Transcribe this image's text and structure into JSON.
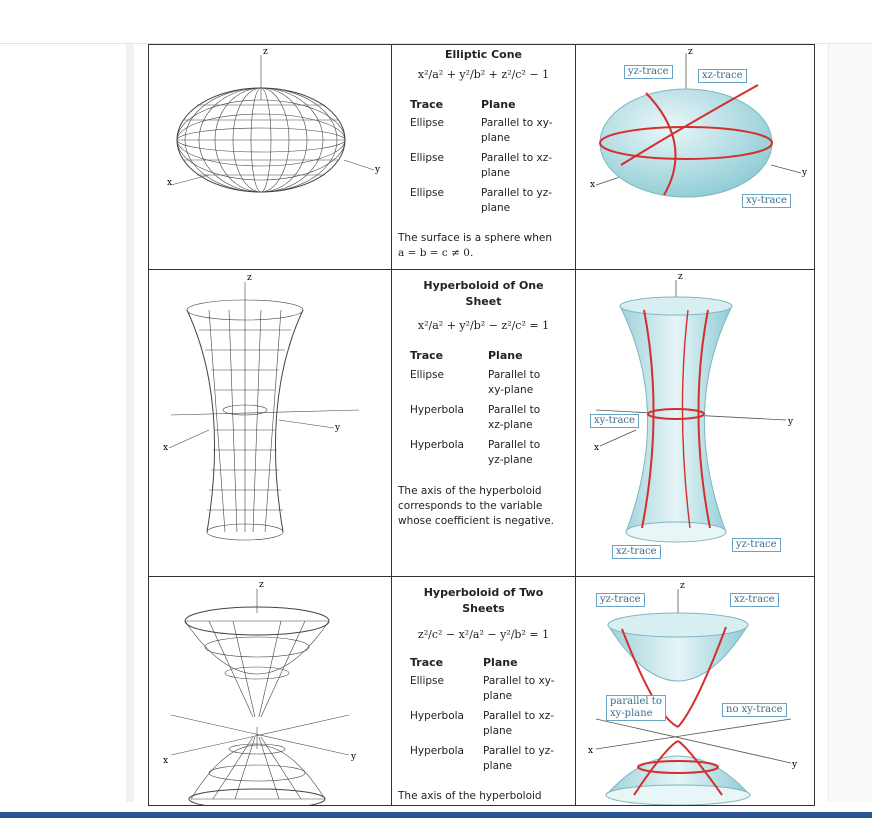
{
  "surfaces": [
    {
      "title": "Elliptic Cone",
      "equation": "x²/a² + y²/b² + z²/c² − 1",
      "headers": {
        "trace": "Trace",
        "plane": "Plane"
      },
      "rows": [
        {
          "trace": "Ellipse",
          "plane1": "Parallel to xy-",
          "plane2": "plane"
        },
        {
          "trace": "Ellipse",
          "plane1": "Parallel to xz-",
          "plane2": "plane"
        },
        {
          "trace": "Ellipse",
          "plane1": "Parallel to yz-",
          "plane2": "plane"
        }
      ],
      "note1": "The surface is a sphere when",
      "note2": "a = b = c ≠ 0.",
      "labels": {
        "yz": "yz-trace",
        "xz": "xz-trace",
        "xy": "xy-trace"
      }
    },
    {
      "title1": "Hyperboloid of One",
      "title2": "Sheet",
      "equation": "x²/a² + y²/b² − z²/c² = 1",
      "headers": {
        "trace": "Trace",
        "plane": "Plane"
      },
      "rows": [
        {
          "trace": "Ellipse",
          "plane1": "Parallel to",
          "plane2": "xy-plane"
        },
        {
          "trace": "Hyperbola",
          "plane1": "Parallel to",
          "plane2": "xz-plane"
        },
        {
          "trace": "Hyperbola",
          "plane1": "Parallel to",
          "plane2": "yz-plane"
        }
      ],
      "note1": "The axis of the hyperboloid",
      "note2": "corresponds to the variable",
      "note3": "whose coefficient is negative.",
      "labels": {
        "xy": "xy-trace",
        "xz": "xz-trace",
        "yz": "yz-trace"
      }
    },
    {
      "title1": "Hyperboloid of Two",
      "title2": "Sheets",
      "equation": "z²/c² − x²/a² − y²/b² = 1",
      "headers": {
        "trace": "Trace",
        "plane": "Plane"
      },
      "rows": [
        {
          "trace": "Ellipse",
          "plane1": "Parallel to xy-",
          "plane2": "plane"
        },
        {
          "trace": "Hyperbola",
          "plane1": "Parallel to xz-",
          "plane2": "plane"
        },
        {
          "trace": "Hyperbola",
          "plane1": "Parallel to yz-",
          "plane2": "plane"
        }
      ],
      "note1": "The axis of the hyperboloid",
      "labels": {
        "yz": "yz-trace",
        "xz": "xz-trace",
        "par1": "parallel to",
        "par2": "xy-plane",
        "noxy": "no xy-trace"
      }
    }
  ],
  "axes": {
    "x": "x",
    "y": "y",
    "z": "z"
  },
  "colors": {
    "surface": "#bfe3e9",
    "trace": "#d32f2f",
    "border": "#333333",
    "bottom_bar": "#2a5698"
  }
}
